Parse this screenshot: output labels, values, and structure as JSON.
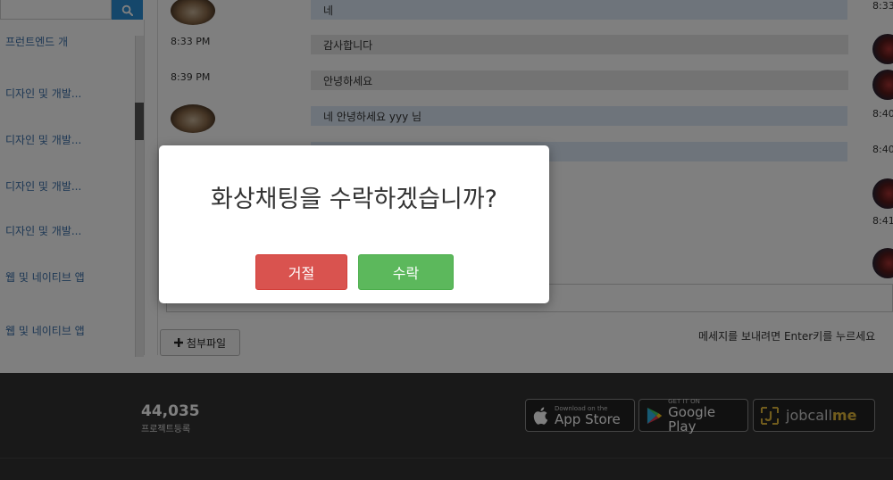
{
  "search": {
    "value": "",
    "placeholder": ""
  },
  "sidebar": {
    "items": [
      {
        "label": "프런트엔드 개"
      },
      {
        "label": "디자인 및 개발..."
      },
      {
        "label": "디자인 및 개발..."
      },
      {
        "label": "디자인 및 개발..."
      },
      {
        "label": "디자인 및 개발..."
      },
      {
        "label": "웹 및 네이티브 앱"
      },
      {
        "label": "웹 및 네이티브 앱"
      }
    ]
  },
  "chat": {
    "messages": [
      {
        "text": "네",
        "time": "8:33"
      },
      {
        "text": "감사합니다",
        "time": "8:33 PM"
      },
      {
        "text": "안녕하세요",
        "time": "8:39 PM"
      },
      {
        "text": "네 안녕하세요 yyy 님",
        "time": "8:40"
      },
      {
        "text": "",
        "time": "8:40"
      },
      {
        "text": "",
        "time": "8:41"
      }
    ],
    "attach_label": "첨부파일",
    "enter_hint": "메세지를 보내려면 Enter키를 누르세요"
  },
  "footer": {
    "stat_value": "44,035",
    "stat_label": "프로젝트등록",
    "app_store_small": "Download on the",
    "app_store_big": "App Store",
    "google_play_small": "GET IT ON",
    "google_play_big": "Google Play",
    "jobcall_main": "jobcall",
    "jobcall_accent": "me"
  },
  "modal": {
    "title": "화상채팅을 수락하겠습니까?",
    "reject_label": "거절",
    "accept_label": "수락"
  },
  "colors": {
    "reject": "#d9534f",
    "accept": "#5cb85c",
    "search_button": "#2b8fd6",
    "jobcall_accent": "#e2b83a"
  }
}
